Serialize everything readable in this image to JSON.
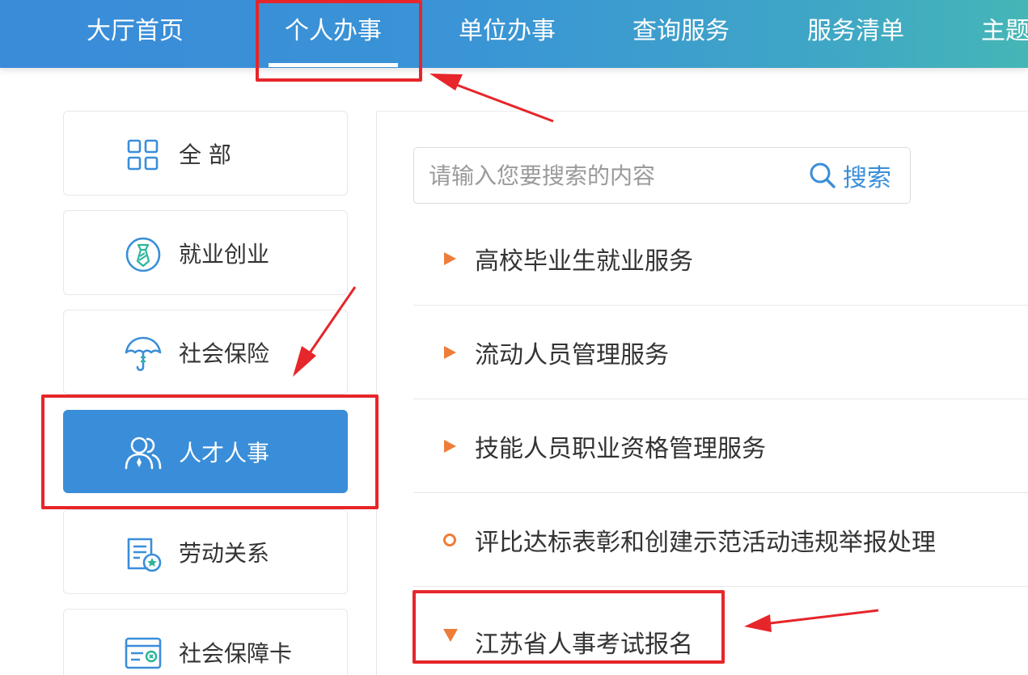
{
  "nav": {
    "items": [
      {
        "label": "大厅首页"
      },
      {
        "label": "个人办事"
      },
      {
        "label": "单位办事"
      },
      {
        "label": "查询服务"
      },
      {
        "label": "服务清单"
      },
      {
        "label": "主题"
      }
    ],
    "active_index": 1
  },
  "sidebar": {
    "items": [
      {
        "label": "全 部",
        "icon": "grid-icon"
      },
      {
        "label": "就业创业",
        "icon": "tie-icon"
      },
      {
        "label": "社会保险",
        "icon": "umbrella-icon"
      },
      {
        "label": "人才人事",
        "icon": "users-icon"
      },
      {
        "label": "劳动关系",
        "icon": "contract-icon"
      },
      {
        "label": "社会保障卡",
        "icon": "card-icon"
      }
    ],
    "active_index": 3
  },
  "search": {
    "placeholder": "请输入您要搜索的内容",
    "value": "",
    "button_label": "搜索"
  },
  "services": [
    {
      "label": "高校毕业生就业服务",
      "marker": "triangle-right"
    },
    {
      "label": "流动人员管理服务",
      "marker": "triangle-right"
    },
    {
      "label": "技能人员职业资格管理服务",
      "marker": "triangle-right"
    },
    {
      "label": "评比达标表彰和创建示范活动违规举报处理",
      "marker": "circle"
    },
    {
      "label": "江苏省人事考试报名",
      "marker": "triangle-down"
    }
  ],
  "colors": {
    "primary": "#3a8ed9",
    "marker": "#ee7d3a",
    "annotation": "#e6262a",
    "icon_blue": "#3a8ed9",
    "icon_green": "#2bb59a"
  }
}
